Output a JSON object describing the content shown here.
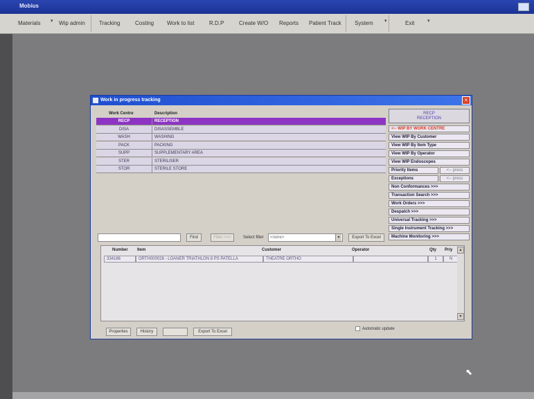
{
  "app": {
    "title": "Mobius"
  },
  "menu": {
    "items": [
      "Materials",
      "Wip admin",
      "Tracking",
      "Costing",
      "Work to list",
      "R.D.P",
      "Create W/O",
      "Reports",
      "Patient Track",
      "System",
      "Exit"
    ]
  },
  "window": {
    "title": "Work in progress tracking",
    "close_label": "×"
  },
  "work_centres": {
    "headers": {
      "code": "Work Centre",
      "description": "Description"
    },
    "rows": [
      {
        "code": "RECP",
        "description": "RECEPTION",
        "selected": true
      },
      {
        "code": "DISA",
        "description": "DISASSEMBLE",
        "selected": false
      },
      {
        "code": "WASH",
        "description": "WASHING",
        "selected": false
      },
      {
        "code": "PACK",
        "description": "PACKING",
        "selected": false
      },
      {
        "code": "SUPP",
        "description": "SUPPLEMENTARY AREA",
        "selected": false
      },
      {
        "code": "STER",
        "description": "STERILISER",
        "selected": false
      },
      {
        "code": "STOR",
        "description": "STERILE STORE",
        "selected": false
      }
    ]
  },
  "right_panel": {
    "current_code": "RECP",
    "current_name": "RECEPTION",
    "buttons": [
      "<-- WIP BY WORK CENTRE",
      "View WIP By Customer",
      "View WIP By Item Type",
      "View WIP By Operator",
      "View WIP Endoscopes",
      "Priority Items",
      "Exceptions",
      "Non Conformances >>>",
      "Transaction Search >>>",
      "Work Orders >>>",
      "Despatch >>>",
      "Universal Tracking >>>",
      "Single Instrument Tracking >>>",
      "Machine Monitoring >>>"
    ],
    "press_label": "<-- press"
  },
  "filter": {
    "find_label": "Find",
    "filter_label": "Filter >>>",
    "select_filter_label": "Select filter",
    "select_value": "<none>",
    "export_label": "Export To Excel"
  },
  "wip_grid": {
    "headers": [
      "Number",
      "Item",
      "Customer",
      "Operator",
      "Qty",
      "Priy"
    ],
    "rows": [
      {
        "number": "334186",
        "item": "ORTH000026 - LOANER TRIATHLON 8 PS PATELLA",
        "customer": "THEATRE ORTHO",
        "operator": "",
        "qty": "1",
        "priy": "N"
      }
    ]
  },
  "bottom": {
    "properties_label": "Properties",
    "history_label": "History",
    "blank_label": "",
    "export_label": "Export To Excel",
    "auto_update_label": "Automatic update"
  },
  "colors": {
    "selection": "#8e34c4",
    "title_bar": "#1f4fd0",
    "red_button": "#d83820"
  }
}
